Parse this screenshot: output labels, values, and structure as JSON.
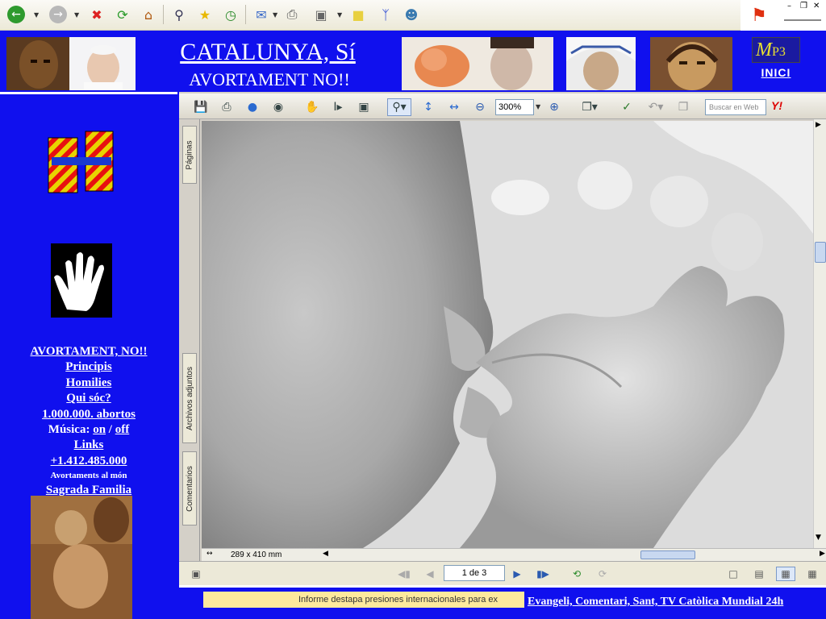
{
  "banner": {
    "title": "CATALUNYA, Sí",
    "subtitle": "AVORTAMENT NO!!",
    "mp3_main": "M",
    "mp3_sub": "P3",
    "inici": "INICI"
  },
  "menu": {
    "items": [
      {
        "label": "AVORTAMENT, NO!!"
      },
      {
        "label": "Principis"
      },
      {
        "label": "Homilies"
      },
      {
        "label": "Qui sóc?"
      },
      {
        "label": "1.000.000. abortos"
      }
    ],
    "music_label": "Música:",
    "music_on": "on",
    "music_slash": "/",
    "music_off": "off",
    "links": "Links",
    "counter": "+1.412.485.000",
    "counter_caption": "Avortaments al món",
    "sagrada": "Sagrada Familia"
  },
  "viewer": {
    "zoom": "300%",
    "search_placeholder": "Buscar en Web",
    "yahoo": "Y!",
    "tabs": {
      "pages": "Páginas",
      "attachments": "Archivos adjuntos",
      "comments": "Comentarios"
    },
    "page_size": "289 x 410 mm",
    "page_indicator": "1 de 3"
  },
  "bottom": {
    "ticker": "Informe destapa presiones internacionales para ex",
    "link": "Evangeli, Comentari, Sant, TV Catòlica Mundial 24h"
  },
  "colors": {
    "page_bg": "#1010ee",
    "ticker_bg": "#fde99d",
    "white": "#ffffff"
  }
}
